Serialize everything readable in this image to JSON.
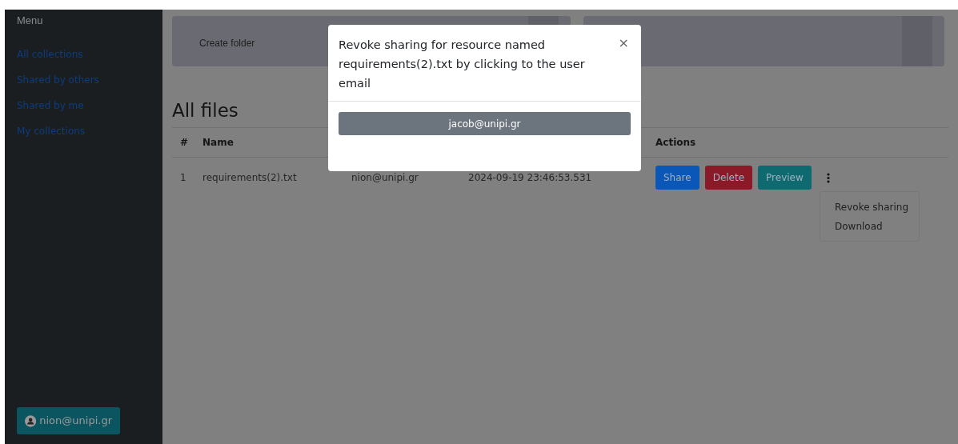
{
  "sidebar": {
    "title": "Menu",
    "items": [
      {
        "label": "All collections"
      },
      {
        "label": "Shared by others"
      },
      {
        "label": "Shared by me"
      },
      {
        "label": "My collections"
      }
    ],
    "user": "nion@unipi.gr"
  },
  "toolbar": {
    "cards": [
      {
        "label": "Create folder"
      }
    ]
  },
  "heading": "All files",
  "table": {
    "header": {
      "number": "#",
      "name": "Name",
      "actions": "Actions"
    },
    "rows": [
      {
        "number": "1",
        "name": "requirements(2).txt",
        "owner": "nion@unipi.gr",
        "date": "2024-09-19 23:46:53.531",
        "actions": [
          {
            "label": "Share",
            "kind": "primary"
          },
          {
            "label": "Delete",
            "kind": "danger"
          },
          {
            "label": "Preview",
            "kind": "info"
          }
        ]
      }
    ]
  },
  "row_menu": {
    "items": [
      "Revoke sharing",
      "Download"
    ]
  },
  "modal": {
    "title": "Revoke sharing for resource named requirements(2).txt by clicking to the user email",
    "close": "×",
    "users": [
      "jacob@unipi.gr"
    ]
  }
}
